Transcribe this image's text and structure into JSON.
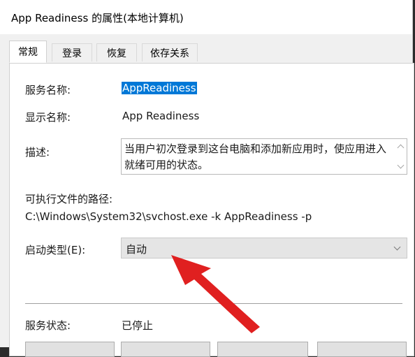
{
  "window": {
    "title": "App Readiness 的属性(本地计算机)"
  },
  "tabs": [
    {
      "label": "常规",
      "active": true
    },
    {
      "label": "登录",
      "active": false
    },
    {
      "label": "恢复",
      "active": false
    },
    {
      "label": "依存关系",
      "active": false
    }
  ],
  "general": {
    "service_name_label": "服务名称:",
    "service_name_value": "AppReadiness",
    "display_name_label": "显示名称:",
    "display_name_value": "App Readiness",
    "description_label": "描述:",
    "description_value": "当用户初次登录到这台电脑和添加新应用时，使应用进入就绪可用的状态。",
    "path_label": "可执行文件的路径:",
    "path_value": "C:\\Windows\\System32\\svchost.exe -k AppReadiness -p",
    "startup_type_label": "启动类型(E):",
    "startup_type_value": "自动",
    "status_label": "服务状态:",
    "status_value": "已停止"
  },
  "colors": {
    "selection": "#0078d7",
    "annotation_arrow": "#e02020"
  }
}
